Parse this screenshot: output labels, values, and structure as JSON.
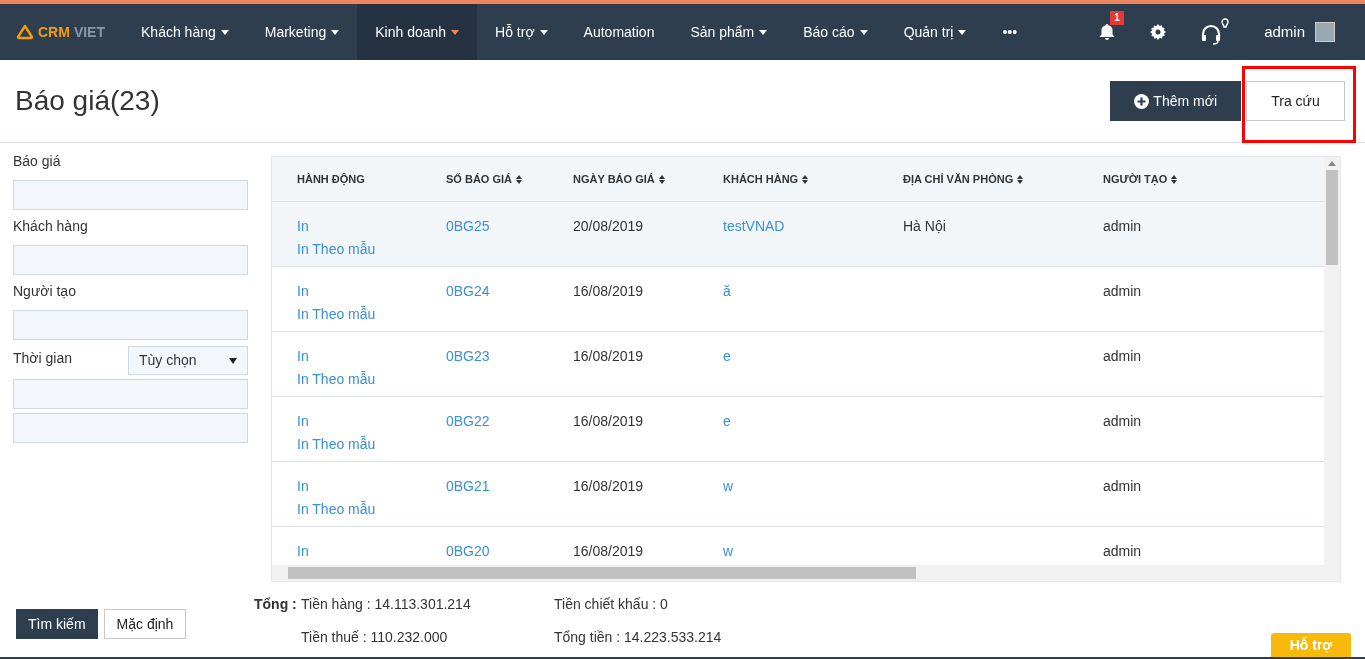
{
  "navbar": {
    "logo": {
      "part_1": "CRM",
      "part_2": "VIET"
    },
    "menu": [
      {
        "label": "Khách hàng",
        "dropdown": true,
        "selected": false
      },
      {
        "label": "Marketing",
        "dropdown": true,
        "selected": false
      },
      {
        "label": "Kinh doanh",
        "dropdown": true,
        "selected": true
      },
      {
        "label": "Hỗ trợ",
        "dropdown": true,
        "selected": false
      },
      {
        "label": "Automation",
        "dropdown": false,
        "selected": false
      },
      {
        "label": "Sản phẩm",
        "dropdown": true,
        "selected": false
      },
      {
        "label": "Báo cáo",
        "dropdown": true,
        "selected": false
      },
      {
        "label": "Quản trị",
        "dropdown": true,
        "selected": false
      },
      {
        "label": "•••",
        "dropdown": false,
        "selected": false
      }
    ],
    "notification_count": "1",
    "user": "admin"
  },
  "page": {
    "title": "Báo giá(23)",
    "buttons": [
      {
        "label": "Thêm mới",
        "kind": "primary",
        "highlighted": false
      },
      {
        "label": "Tra cứu",
        "kind": "secondary",
        "highlighted": true
      }
    ]
  },
  "filters": {
    "fields": [
      {
        "label": "Báo giá"
      },
      {
        "label": "Khách hàng"
      },
      {
        "label": "Người tạo"
      }
    ],
    "time": {
      "label": "Thời gian",
      "select": "Tùy chọn"
    },
    "buttons": [
      {
        "label": "Tìm kiếm",
        "kind": "primary"
      },
      {
        "label": "Mặc định",
        "kind": "secondary"
      }
    ]
  },
  "table": {
    "columns": [
      {
        "label": "HÀNH ĐỘNG",
        "sortable": false
      },
      {
        "label": "SỐ BÁO GIÁ",
        "sortable": true
      },
      {
        "label": "NGÀY BÁO GIÁ",
        "sortable": true
      },
      {
        "label": "KHÁCH HÀNG",
        "sortable": true
      },
      {
        "label": "ĐỊA CHỈ VĂN PHÒNG",
        "sortable": true
      },
      {
        "label": "NGƯỜI TẠO",
        "sortable": true
      }
    ],
    "rows": [
      {
        "selected": true,
        "actions": [
          "In",
          "In Theo mẫu"
        ],
        "number": "0BG25",
        "date": "20/08/2019",
        "customer": "testVNAD",
        "address": "Hà Nội",
        "creator": "admin"
      },
      {
        "selected": false,
        "actions": [
          "In",
          "In Theo mẫu"
        ],
        "number": "0BG24",
        "date": "16/08/2019",
        "customer": "ă",
        "address": "",
        "creator": "admin"
      },
      {
        "selected": false,
        "actions": [
          "In",
          "In Theo mẫu"
        ],
        "number": "0BG23",
        "date": "16/08/2019",
        "customer": "e",
        "address": "",
        "creator": "admin"
      },
      {
        "selected": false,
        "actions": [
          "In",
          "In Theo mẫu"
        ],
        "number": "0BG22",
        "date": "16/08/2019",
        "customer": "e",
        "address": "",
        "creator": "admin"
      },
      {
        "selected": false,
        "actions": [
          "In",
          "In Theo mẫu"
        ],
        "number": "0BG21",
        "date": "16/08/2019",
        "customer": "w",
        "address": "",
        "creator": "admin"
      },
      {
        "selected": false,
        "actions": [
          "In"
        ],
        "number": "0BG20",
        "date": "16/08/2019",
        "customer": "w",
        "address": "",
        "creator": "admin"
      }
    ]
  },
  "totals": {
    "label": "Tổng :",
    "items": [
      "Tiền hàng : 14.113.301.214",
      "Tiền chiết khấu : 0",
      "Tiền thuế : 110.232.000",
      "Tổng tiền : 14.223.533.214"
    ]
  },
  "help_button": "Hỗ trợ"
}
